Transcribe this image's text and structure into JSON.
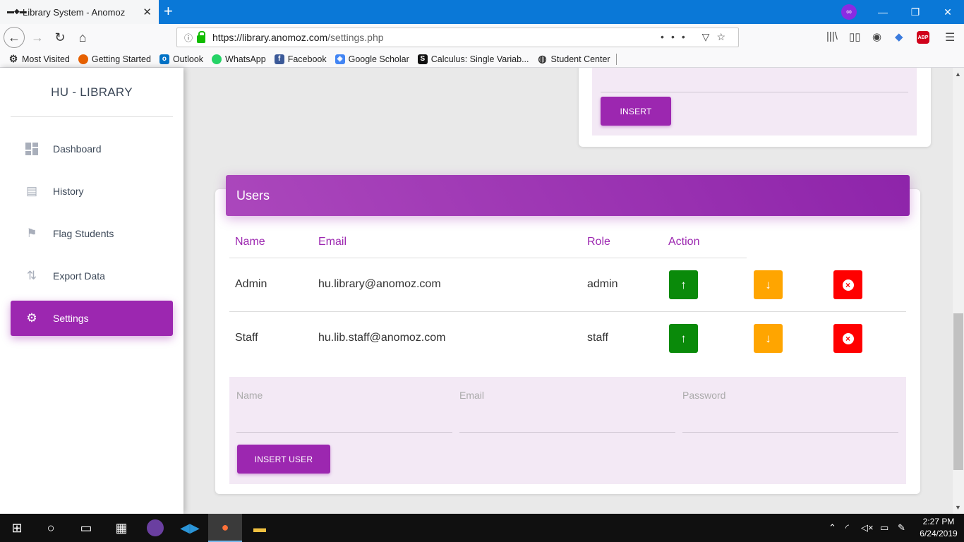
{
  "browser": {
    "tab_title": "Library System - Anomoz",
    "tab_close": "✕",
    "new_tab": "+",
    "url_domain": "https://library.anomoz.com",
    "url_path": "/settings.php",
    "url_more": "•••",
    "bookmarks": [
      {
        "label": "Most Visited",
        "icon": "gear-icon"
      },
      {
        "label": "Getting Started",
        "icon": "firefox-icon"
      },
      {
        "label": "Outlook",
        "icon": "outlook-icon"
      },
      {
        "label": "WhatsApp",
        "icon": "whatsapp-icon"
      },
      {
        "label": "Facebook",
        "icon": "facebook-icon"
      },
      {
        "label": "Google Scholar",
        "icon": "scholar-icon"
      },
      {
        "label": "Calculus: Single Variab...",
        "icon": "calculus-icon"
      },
      {
        "label": "Student Center",
        "icon": "globe-icon"
      }
    ]
  },
  "sidebar": {
    "brand": "HU - LIBRARY",
    "items": [
      {
        "label": "Dashboard",
        "icon": "dashboard-icon"
      },
      {
        "label": "History",
        "icon": "history-icon"
      },
      {
        "label": "Flag Students",
        "icon": "flag-icon"
      },
      {
        "label": "Export Data",
        "icon": "export-icon"
      },
      {
        "label": "Settings",
        "icon": "gear-icon",
        "active": true
      }
    ]
  },
  "top_card": {
    "insert_label": "INSERT"
  },
  "users": {
    "title": "Users",
    "columns": [
      "Name",
      "Email",
      "Role",
      "Action"
    ],
    "rows": [
      {
        "name": "Admin",
        "email": "hu.library@anomoz.com",
        "role": "admin"
      },
      {
        "name": "Staff",
        "email": "hu.lib.staff@anomoz.com",
        "role": "staff"
      }
    ],
    "form": {
      "name_label": "Name",
      "email_label": "Email",
      "password_label": "Password",
      "submit_label": "INSERT USER"
    }
  },
  "taskbar": {
    "time": "2:27 PM",
    "date": "6/24/2019"
  },
  "colors": {
    "accent": "#9c27b0",
    "promote": "#0a8a0a",
    "demote": "#ffa500",
    "delete": "#ff0000"
  }
}
